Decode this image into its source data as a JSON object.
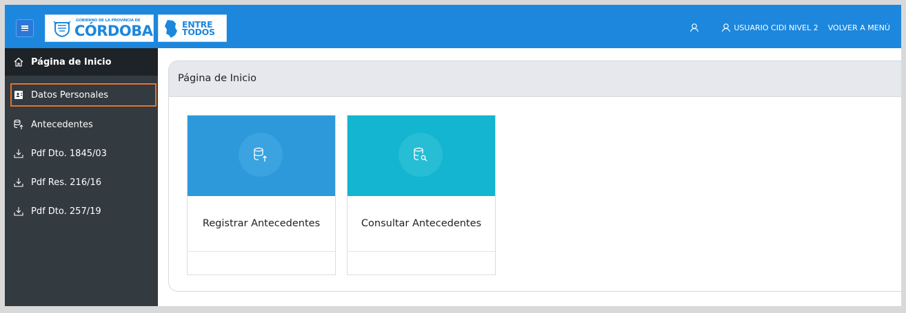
{
  "header": {
    "logo_cordoba_small": "GOBIERNO DE LA PROVINCIA DE",
    "logo_cordoba_big": "CÓRDOBA",
    "logo_entre_line1": "ENTRE",
    "logo_entre_line2": "TODOS",
    "user_label": "USUARIO CIDI NIVEL 2",
    "back_label": "VOLVER A MENÚ",
    "icons": [
      "menu-icon",
      "user-icon",
      "user-icon"
    ],
    "bar_color": "#1c87dd"
  },
  "sidebar": {
    "items": [
      {
        "label": "Página de Inicio",
        "icon": "home-icon"
      },
      {
        "label": "Datos Personales",
        "icon": "id-card-icon"
      },
      {
        "label": "Antecedentes",
        "icon": "database-upload-icon"
      },
      {
        "label": "Pdf Dto. 1845/03",
        "icon": "download-icon"
      },
      {
        "label": "Pdf Res. 216/16",
        "icon": "download-icon"
      },
      {
        "label": "Pdf Dto. 257/19",
        "icon": "download-icon"
      }
    ],
    "highlight_color": "#e9722d",
    "background": "#333a40"
  },
  "main": {
    "title": "Página de Inicio",
    "cards": [
      {
        "label": "Registrar Antecedentes",
        "icon": "database-upload-icon",
        "color": "#2d99db"
      },
      {
        "label": "Consultar Antecedentes",
        "icon": "database-search-icon",
        "color": "#13b5d0"
      }
    ]
  }
}
